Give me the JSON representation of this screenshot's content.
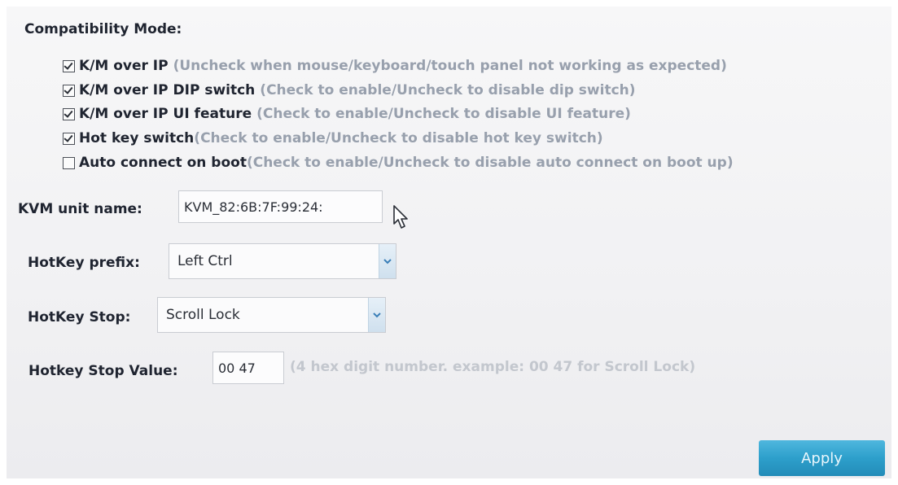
{
  "compatibility": {
    "title": "Compatibility Mode:",
    "options": [
      {
        "label": "K/M over IP",
        "hint": "(Uncheck when mouse/keyboard/touch panel not working as expected)",
        "checked": true
      },
      {
        "label": "K/M over IP DIP switch",
        "hint": "(Check to enable/Uncheck to disable dip switch)",
        "checked": true
      },
      {
        "label": "K/M over IP UI feature",
        "hint": "(Check to enable/Uncheck to disable UI feature)",
        "checked": true
      },
      {
        "label": "Hot key switch",
        "hint": "(Check to enable/Uncheck to disable hot key switch)",
        "checked": true
      },
      {
        "label": "Auto connect on boot",
        "hint": "(Check to enable/Uncheck to disable auto connect on boot up)",
        "checked": false
      }
    ]
  },
  "unit_name": {
    "label": "KVM unit name:",
    "value": "KVM_82:6B:7F:99:24:"
  },
  "hotkey_prefix": {
    "label": "HotKey prefix:",
    "selected": "Left Ctrl"
  },
  "hotkey_stop": {
    "label": "HotKey Stop:",
    "selected": "Scroll Lock"
  },
  "hotkey_stop_value": {
    "label": "Hotkey Stop Value:",
    "value": "00 47",
    "hint": "(4 hex digit number. example: 00 47 for Scroll Lock)"
  },
  "apply": {
    "label": "Apply"
  },
  "icons": {
    "dropdown": "chevron-down-icon",
    "pointer": "mouse-pointer-icon"
  },
  "colors": {
    "hint_text": "#98a0ad",
    "muted_hint": "#c3c7ce",
    "button": "#2d9fcb"
  }
}
